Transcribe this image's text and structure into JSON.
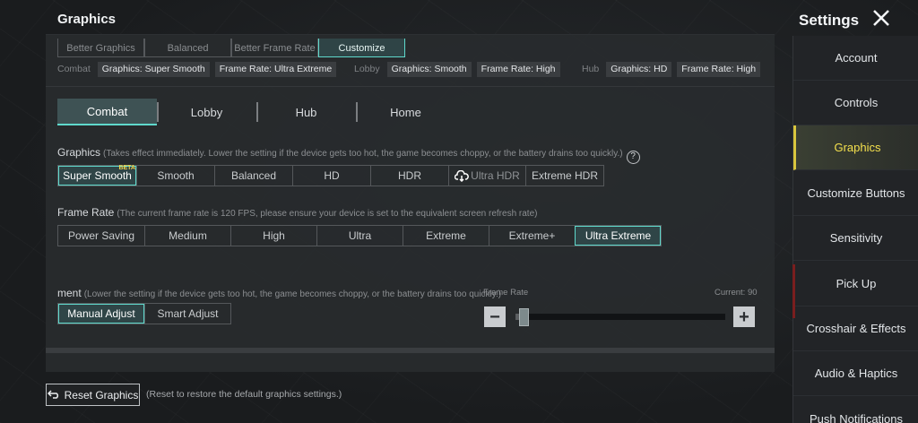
{
  "header": {
    "title": "Graphics"
  },
  "settings": {
    "title": "Settings"
  },
  "presets": {
    "options": [
      "Better Graphics",
      "Balanced",
      "Better Frame Rate",
      "Customize"
    ],
    "selected": "Customize"
  },
  "summary": {
    "combat": {
      "label": "Combat",
      "graphics": "Graphics: Super Smooth",
      "frame_rate": "Frame Rate: Ultra Extreme"
    },
    "lobby": {
      "label": "Lobby",
      "graphics": "Graphics: Smooth",
      "frame_rate": "Frame Rate: High"
    },
    "hub": {
      "label": "Hub",
      "graphics": "Graphics: HD",
      "frame_rate": "Frame Rate: High"
    }
  },
  "mode_tabs": {
    "items": [
      "Combat",
      "Lobby",
      "Hub",
      "Home"
    ],
    "selected": "Combat"
  },
  "graphics_section": {
    "title": "Graphics",
    "hint": "(Takes effect immediately. Lower the setting if the device gets too hot, the game becomes choppy, or the battery drains too quickly.)",
    "help_icon": "?",
    "options": [
      "Super Smooth",
      "Smooth",
      "Balanced",
      "HD",
      "HDR",
      "Ultra HDR",
      "Extreme HDR"
    ],
    "selected": "Super Smooth",
    "beta_badge": "BETA"
  },
  "frame_rate_section": {
    "title": "Frame Rate",
    "hint": "(The current frame rate is 120 FPS, please ensure your device is set to the equivalent screen refresh rate)",
    "options": [
      "Power Saving",
      "Medium",
      "High",
      "Ultra",
      "Extreme",
      "Extreme+",
      "Ultra Extreme"
    ],
    "selected": "Ultra Extreme"
  },
  "adjustment_section": {
    "title": "ment",
    "hint": "(Lower the setting if the device gets too hot, the game becomes choppy, or the battery drains too quickly.)",
    "options": [
      "Manual Adjust",
      "Smart Adjust"
    ],
    "selected": "Manual Adjust",
    "slider": {
      "label": "Frame Rate",
      "current": "Current: 90",
      "minus": "−",
      "plus": "+",
      "fraction": 0.02
    }
  },
  "reset": {
    "label": "Reset Graphics",
    "hint": "(Reset to restore the default graphics settings.)"
  },
  "sidebar": {
    "items": [
      "Account",
      "Controls",
      "Graphics",
      "Customize Buttons",
      "Sensitivity",
      "Pick Up",
      "Crosshair & Effects",
      "Audio & Haptics",
      "Push Notifications"
    ],
    "selected": "Graphics"
  },
  "colors": {
    "accent": "#5fd9cc",
    "sidebar_active": "#f4e04d",
    "beta": "#f2d34a"
  },
  "icons": {
    "close": "close-icon",
    "help": "help-icon",
    "reset": "undo-icon",
    "cloud": "cloud-download-icon"
  }
}
